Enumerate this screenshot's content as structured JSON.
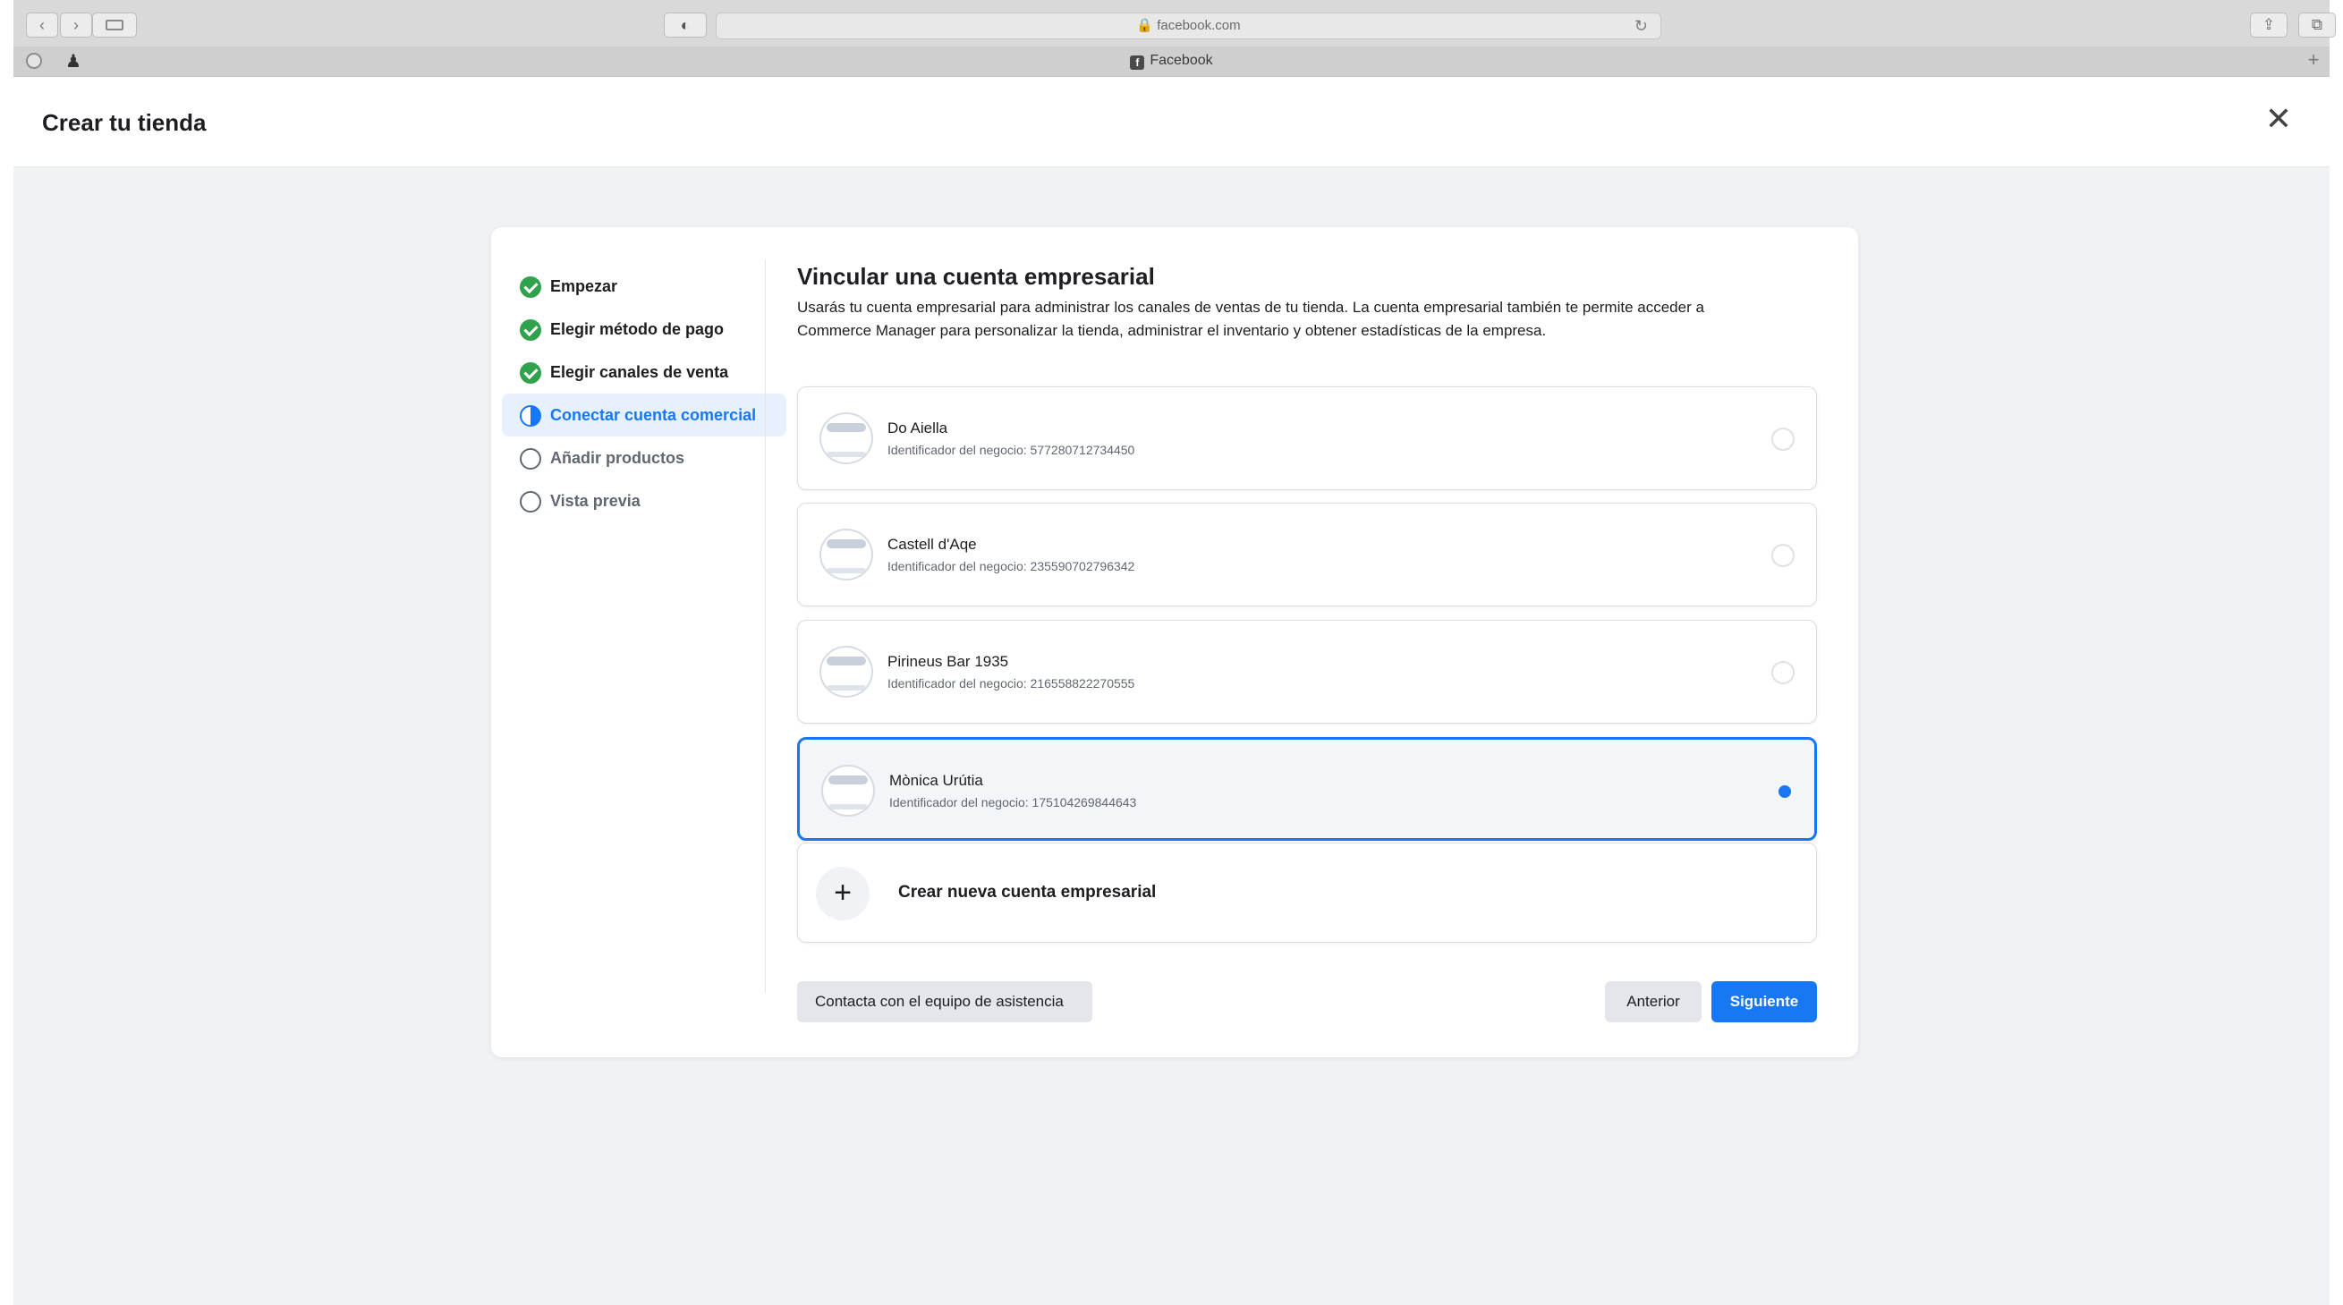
{
  "browser": {
    "url": "🔒 facebook.com",
    "tab_title": "Facebook",
    "tab_icon": "f"
  },
  "modal": {
    "title": "Crear tu tienda",
    "close_glyph": "✕"
  },
  "steps": [
    {
      "label": "Empezar",
      "state": "done"
    },
    {
      "label": "Elegir método de pago",
      "state": "done"
    },
    {
      "label": "Elegir canales de venta",
      "state": "done"
    },
    {
      "label": "Conectar cuenta comercial",
      "state": "current"
    },
    {
      "label": "Añadir productos",
      "state": "todo"
    },
    {
      "label": "Vista previa",
      "state": "todo"
    }
  ],
  "content": {
    "title": "Vincular una cuenta empresarial",
    "description": "Usarás tu cuenta empresarial para administrar los canales de ventas de tu tienda. La cuenta empresarial también te permite acceder a Commerce Manager para personalizar la tienda, administrar el inventario y obtener estadísticas de la empresa."
  },
  "accounts": [
    {
      "name": "Do Aiella",
      "id": "Identificador del negocio: 577280712734450",
      "selected": false
    },
    {
      "name": "Castell d'Aqe",
      "id": "Identificador del negocio: 235590702796342",
      "selected": false
    },
    {
      "name": "Pirineus Bar 1935",
      "id": "Identificador del negocio: 216558822270555",
      "selected": false
    },
    {
      "name": "Mònica Urútia",
      "id": "Identificador del negocio: 175104269844643",
      "selected": true
    }
  ],
  "create_account": {
    "plus_glyph": "+",
    "label": "Crear nueva cuenta empresarial"
  },
  "footer": {
    "support_label": "Contacta con el equipo de asistencia",
    "prev_label": "Anterior",
    "next_label": "Siguiente"
  },
  "colors": {
    "accent": "#1877f2",
    "success": "#31a24c",
    "page_bg": "#f0f2f5"
  }
}
